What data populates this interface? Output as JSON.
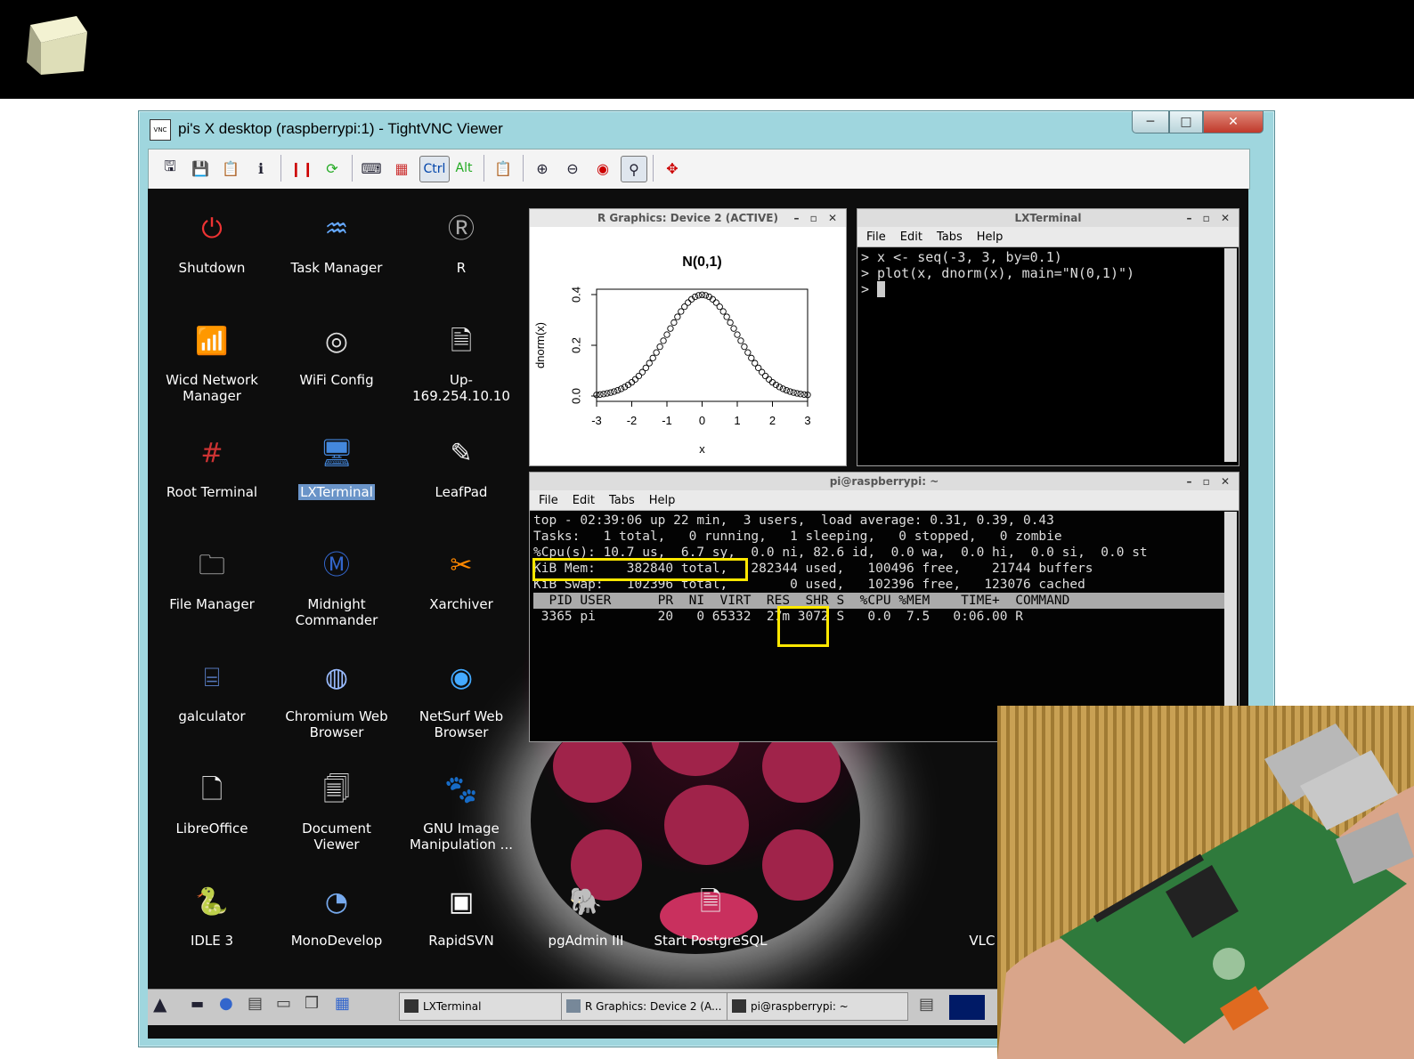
{
  "vnc": {
    "title": "pi's X desktop (raspberrypi:1) - TightVNC Viewer",
    "toolbar_ctrl": "Ctrl",
    "toolbar_alt": "Alt"
  },
  "desktop_icons": [
    {
      "label": "Shutdown"
    },
    {
      "label": "Task Manager"
    },
    {
      "label": "R"
    },
    {
      "label": "Wicd Network Manager"
    },
    {
      "label": "WiFi Config"
    },
    {
      "label": "Up-169.254.10.10"
    },
    {
      "label": "Root Terminal"
    },
    {
      "label": "LXTerminal"
    },
    {
      "label": "LeafPad"
    },
    {
      "label": "File Manager"
    },
    {
      "label": "Midnight Commander"
    },
    {
      "label": "Xarchiver"
    },
    {
      "label": "galculator"
    },
    {
      "label": "Chromium Web Browser"
    },
    {
      "label": "NetSurf Web Browser"
    },
    {
      "label": "LibreOffice"
    },
    {
      "label": "Document Viewer"
    },
    {
      "label": "GNU Image Manipulation ..."
    },
    {
      "label": "IDLE 3"
    },
    {
      "label": "MonoDevelop"
    },
    {
      "label": "RapidSVN"
    },
    {
      "label": "pgAdmin III"
    },
    {
      "label": "Start PostgreSQL"
    },
    {
      "label": "VLC med player"
    }
  ],
  "rgraph": {
    "title": "R Graphics: Device 2 (ACTIVE)"
  },
  "chart_data": {
    "type": "scatter",
    "title": "N(0,1)",
    "xlabel": "x",
    "ylabel": "dnorm(x)",
    "xlim": [
      -3,
      3
    ],
    "ylim": [
      0,
      0.4
    ],
    "x_ticks": [
      "-3",
      "-2",
      "-1",
      "0",
      "1",
      "2",
      "3"
    ],
    "y_ticks": [
      "0.0",
      "0.2",
      "0.4"
    ],
    "x_seq": {
      "from": -3,
      "to": 3,
      "by": 0.1
    }
  },
  "lxterm1": {
    "title": "LXTerminal",
    "menu": [
      "File",
      "Edit",
      "Tabs",
      "Help"
    ],
    "lines": [
      "> x <- seq(-3, 3, by=0.1)",
      "> plot(x, dnorm(x), main=\"N(0,1)\")",
      "> "
    ]
  },
  "lxterm2": {
    "title": "pi@raspberrypi: ~",
    "menu": [
      "File",
      "Edit",
      "Tabs",
      "Help"
    ],
    "lines": [
      "top - 02:39:06 up 22 min,  3 users,  load average: 0.31, 0.39, 0.43",
      "Tasks:   1 total,   0 running,   1 sleeping,   0 stopped,   0 zombie",
      "%Cpu(s): 10.7 us,  6.7 sy,  0.0 ni, 82.6 id,  0.0 wa,  0.0 hi,  0.0 si,  0.0 st",
      "KiB Mem:    382840 total,   282344 used,   100496 free,    21744 buffers",
      "KiB Swap:   102396 total,        0 used,   102396 free,   123076 cached",
      ""
    ],
    "header": "  PID USER      PR  NI  VIRT  RES  SHR S  %CPU %MEM    TIME+  COMMAND",
    "row": " 3365 pi        20   0 65332  27m 3072 S   0.0  7.5   0:06.00 R"
  },
  "taskbar": {
    "items": [
      "LXTerminal",
      "R Graphics: Device 2 (A...",
      "pi@raspberrypi: ~"
    ]
  }
}
